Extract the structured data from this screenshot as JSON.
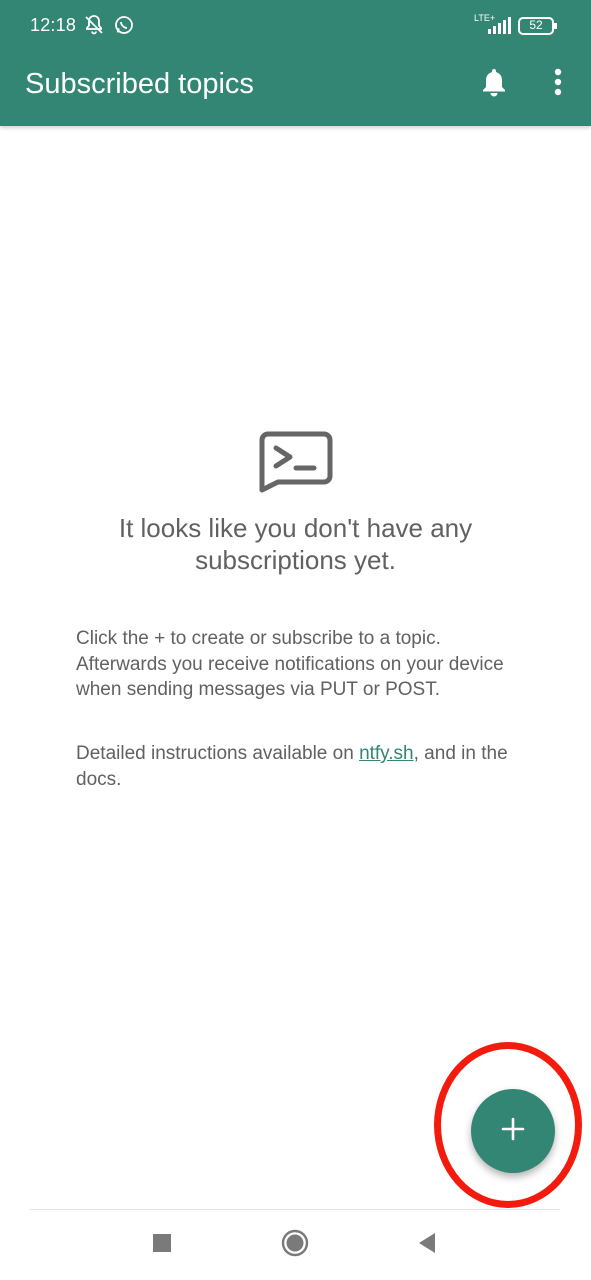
{
  "status_bar": {
    "time": "12:18",
    "network": "LTE+",
    "battery": "52",
    "icons": [
      "muted-bell-icon",
      "whatsapp-icon",
      "signal-icon",
      "battery-icon"
    ]
  },
  "toolbar": {
    "title": "Subscribed topics",
    "notifications_icon": "bell-icon",
    "menu_icon": "overflow-menu-icon"
  },
  "empty_state": {
    "icon": "terminal-message-icon",
    "title": "It looks like you don't have any subscriptions yet.",
    "description": "Click the + to create or subscribe to a topic. Afterwards you receive notifications on your device when sending messages via PUT or POST.",
    "details_prefix": "Detailed instructions available on ",
    "details_link": "ntfy.sh",
    "details_suffix": ", and in the docs."
  },
  "fab": {
    "icon": "plus-icon"
  },
  "nav_bar": {
    "icons": [
      "recents-square-icon",
      "home-circle-icon",
      "back-triangle-icon"
    ]
  },
  "colors": {
    "primary": "#338574",
    "highlight": "#f21b0d",
    "text_secondary": "#616161"
  }
}
